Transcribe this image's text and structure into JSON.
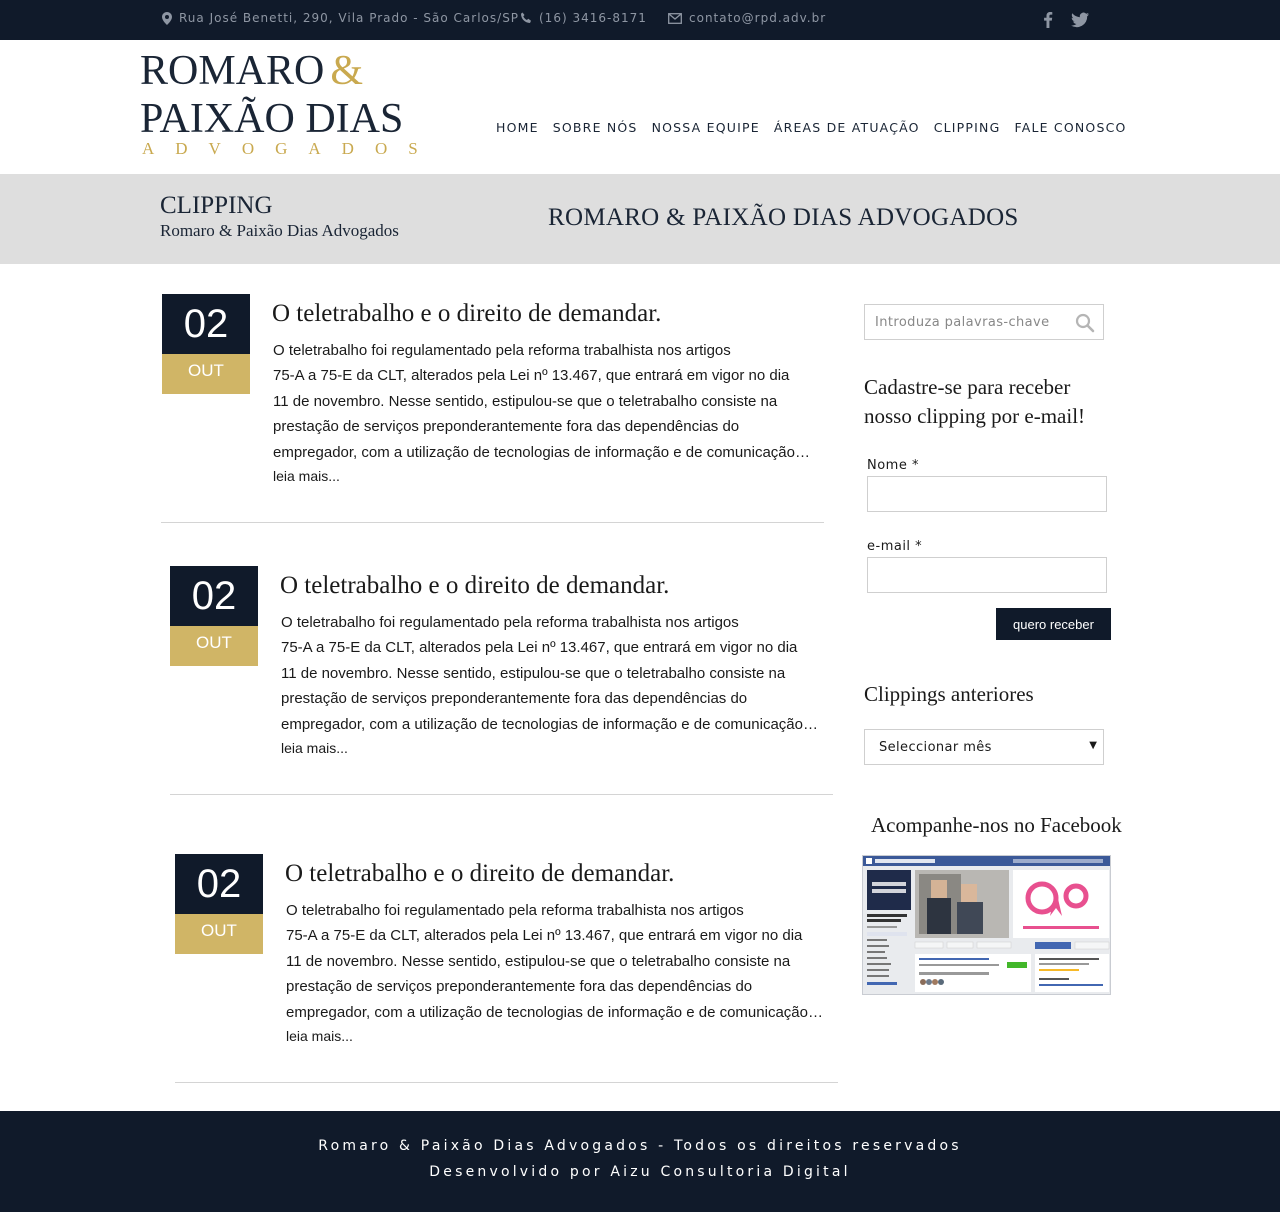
{
  "topbar": {
    "address": "Rua José Benetti, 290, Vila Prado - São Carlos/SP",
    "phone": "(16) 3416-8171",
    "email": "contato@rpd.adv.br",
    "icons": [
      "map-pin-icon",
      "phone-icon",
      "envelope-icon",
      "facebook-icon",
      "twitter-icon"
    ]
  },
  "logo": {
    "line1": "ROMARO",
    "amp": "&",
    "line2": "PAIXÃO DIAS",
    "line3": "ADVOGADOS"
  },
  "nav": [
    "HOME",
    "SOBRE NÓS",
    "NOSSA EQUIPE",
    "ÁREAS DE ATUAÇÃO",
    "CLIPPING",
    "FALE CONOSCO"
  ],
  "banner": {
    "title": "CLIPPING",
    "subtitle": "Romaro & Paixão Dias Advogados",
    "right": "ROMARO & PAIXÃO DIAS ADVOGADOS"
  },
  "posts": [
    {
      "day": "02",
      "month": "OUT",
      "title": "O teletrabalho e o direito de demandar.",
      "lines": [
        "O teletrabalho foi regulamentado pela reforma trabalhista nos artigos",
        "75-A a 75-E da CLT, alterados pela Lei nº 13.467, que entrará em vigor no dia",
        "11 de novembro. Nesse sentido, estipulou-se que o teletrabalho consiste na",
        "prestação de serviços preponderantemente fora das dependências do",
        "empregador, com a utilização de tecnologias de informação e de comunicação…"
      ],
      "read_more": "leia mais..."
    },
    {
      "day": "02",
      "month": "OUT",
      "title": "O teletrabalho e o direito de demandar.",
      "lines": [
        "O teletrabalho foi regulamentado pela reforma trabalhista nos artigos",
        "75-A a 75-E da CLT, alterados pela Lei nº 13.467, que entrará em vigor no dia",
        "11 de novembro. Nesse sentido, estipulou-se que o teletrabalho consiste na",
        "prestação de serviços preponderantemente fora das dependências do",
        "empregador, com a utilização de tecnologias de informação e de comunicação…"
      ],
      "read_more": "leia mais..."
    },
    {
      "day": "02",
      "month": "OUT",
      "title": "O teletrabalho e o direito de demandar.",
      "lines": [
        "O teletrabalho foi regulamentado pela reforma trabalhista nos artigos",
        "75-A a 75-E da CLT, alterados pela Lei nº 13.467, que entrará em vigor no dia",
        "11 de novembro. Nesse sentido, estipulou-se que o teletrabalho consiste na",
        "prestação de serviços preponderantemente fora das dependências do",
        "empregador, com a utilização de tecnologias de informação e de comunicação…"
      ],
      "read_more": "leia mais..."
    }
  ],
  "sidebar": {
    "search_placeholder": "Introduza palavras-chave",
    "signup_line1": "Cadastre-se para receber",
    "signup_line2": "nosso clipping por e-mail!",
    "name_label": "Nome *",
    "email_label": "e-mail *",
    "name_value": "",
    "email_value": "",
    "submit_label": "quero receber",
    "archive_heading": "Clippings anteriores",
    "archive_select": "Seleccionar mês",
    "facebook_heading": "Acompanhe-nos no Facebook"
  },
  "footer": {
    "line1": "Romaro & Paixão Dias Advogados - Todos os direitos reservados",
    "line2": "Desenvolvido por Aizu Consultoria Digital"
  },
  "colors": {
    "navy": "#101a2a",
    "gold": "#d0b566",
    "banner_gray": "#dedede"
  }
}
